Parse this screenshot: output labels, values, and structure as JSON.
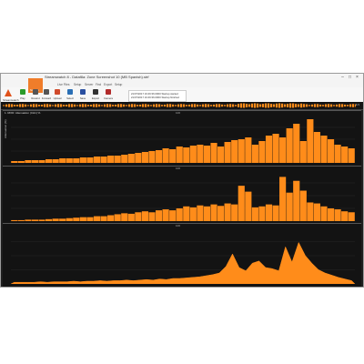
{
  "window": {
    "title": "Streamwatch 8 - Dataf8a: Zone Screenshot 10 (MB Spanish).strf"
  },
  "ribbon_tabs": [
    "Live Files",
    "Setup",
    "Server",
    "Find",
    "Export",
    "Setup"
  ],
  "logo": {
    "label": "Streamwatch"
  },
  "app_menu": {
    "label": "Stream"
  },
  "ribbon_buttons": [
    {
      "label": "Play",
      "icon": "play-icon",
      "color": "#2a9b2a"
    },
    {
      "label": "Rewind",
      "icon": "rewind-icon",
      "color": "#555555"
    },
    {
      "label": "Forward",
      "icon": "forward-icon",
      "color": "#555555"
    },
    {
      "label": "Upload",
      "icon": "upload-icon",
      "color": "#d04a2c"
    },
    {
      "label": "Select",
      "icon": "select-icon",
      "color": "#2a6fb5"
    },
    {
      "label": "Save",
      "icon": "save-icon",
      "color": "#2a4fa0"
    },
    {
      "label": "Export",
      "icon": "export-icon",
      "color": "#333333"
    },
    {
      "label": "Camera",
      "icon": "camera-icon",
      "color": "#b22b2b"
    }
  ],
  "log": [
    "21/07/2017 16:46:36.0000  Startup started",
    "21/07/2017 16:46:36.0000  Startup finished"
  ],
  "overview": {
    "badge": "1/1"
  },
  "panels": [
    {
      "id": "panel-1",
      "header": "1. RFID: Attenuation (CH1) %",
      "mid_label": "100",
      "y_label": "Attenuation (%)",
      "y_max": 5,
      "chart_data": {
        "type": "bar",
        "color": "#ff8c1a",
        "ylim": [
          0,
          5
        ],
        "values": [
          0.2,
          0.2,
          0.3,
          0.3,
          0.3,
          0.4,
          0.4,
          0.5,
          0.5,
          0.5,
          0.6,
          0.6,
          0.7,
          0.7,
          0.8,
          0.8,
          0.9,
          1.0,
          1.1,
          1.2,
          1.3,
          1.4,
          1.6,
          1.5,
          1.8,
          1.7,
          1.9,
          2.0,
          1.9,
          2.2,
          1.8,
          2.3,
          2.5,
          2.6,
          2.8,
          2.0,
          2.4,
          3.0,
          3.2,
          2.8,
          3.8,
          4.3,
          2.4,
          4.8,
          3.4,
          3.0,
          2.6,
          2.0,
          1.8,
          1.6
        ]
      }
    },
    {
      "id": "panel-2",
      "header": "",
      "mid_label": "100",
      "y_label": "",
      "y_max": 10,
      "chart_data": {
        "type": "bar",
        "color": "#ff8c1a",
        "ylim": [
          0,
          10
        ],
        "values": [
          0.2,
          0.2,
          0.3,
          0.3,
          0.3,
          0.4,
          0.5,
          0.5,
          0.6,
          0.7,
          0.8,
          0.8,
          1.0,
          1.0,
          1.2,
          1.4,
          1.6,
          1.5,
          1.8,
          2.0,
          1.8,
          2.2,
          2.4,
          2.2,
          2.6,
          3.0,
          2.8,
          3.2,
          3.0,
          3.4,
          3.1,
          3.6,
          3.4,
          7.2,
          6.0,
          2.8,
          3.0,
          3.4,
          3.2,
          9.0,
          5.8,
          8.2,
          6.2,
          3.8,
          3.6,
          3.0,
          2.6,
          2.4,
          2.0,
          1.8
        ]
      }
    },
    {
      "id": "panel-3",
      "header": "",
      "mid_label": "100",
      "y_label": "",
      "y_max": 10,
      "chart_data": {
        "type": "area",
        "color": "#ff8c1a",
        "ylim": [
          0,
          10
        ],
        "values": [
          0.3,
          0.3,
          0.3,
          0.3,
          0.4,
          0.3,
          0.4,
          0.4,
          0.4,
          0.5,
          0.4,
          0.5,
          0.5,
          0.6,
          0.5,
          0.6,
          0.6,
          0.7,
          0.6,
          0.7,
          0.8,
          0.7,
          0.9,
          0.8,
          1.0,
          1.0,
          1.1,
          1.2,
          1.3,
          1.5,
          1.7,
          2.0,
          3.2,
          5.5,
          3.0,
          2.4,
          3.8,
          4.2,
          3.0,
          2.8,
          2.4,
          6.8,
          4.0,
          7.6,
          5.2,
          3.8,
          2.6,
          2.0,
          1.6,
          1.2,
          0.9,
          0.6
        ]
      }
    }
  ]
}
